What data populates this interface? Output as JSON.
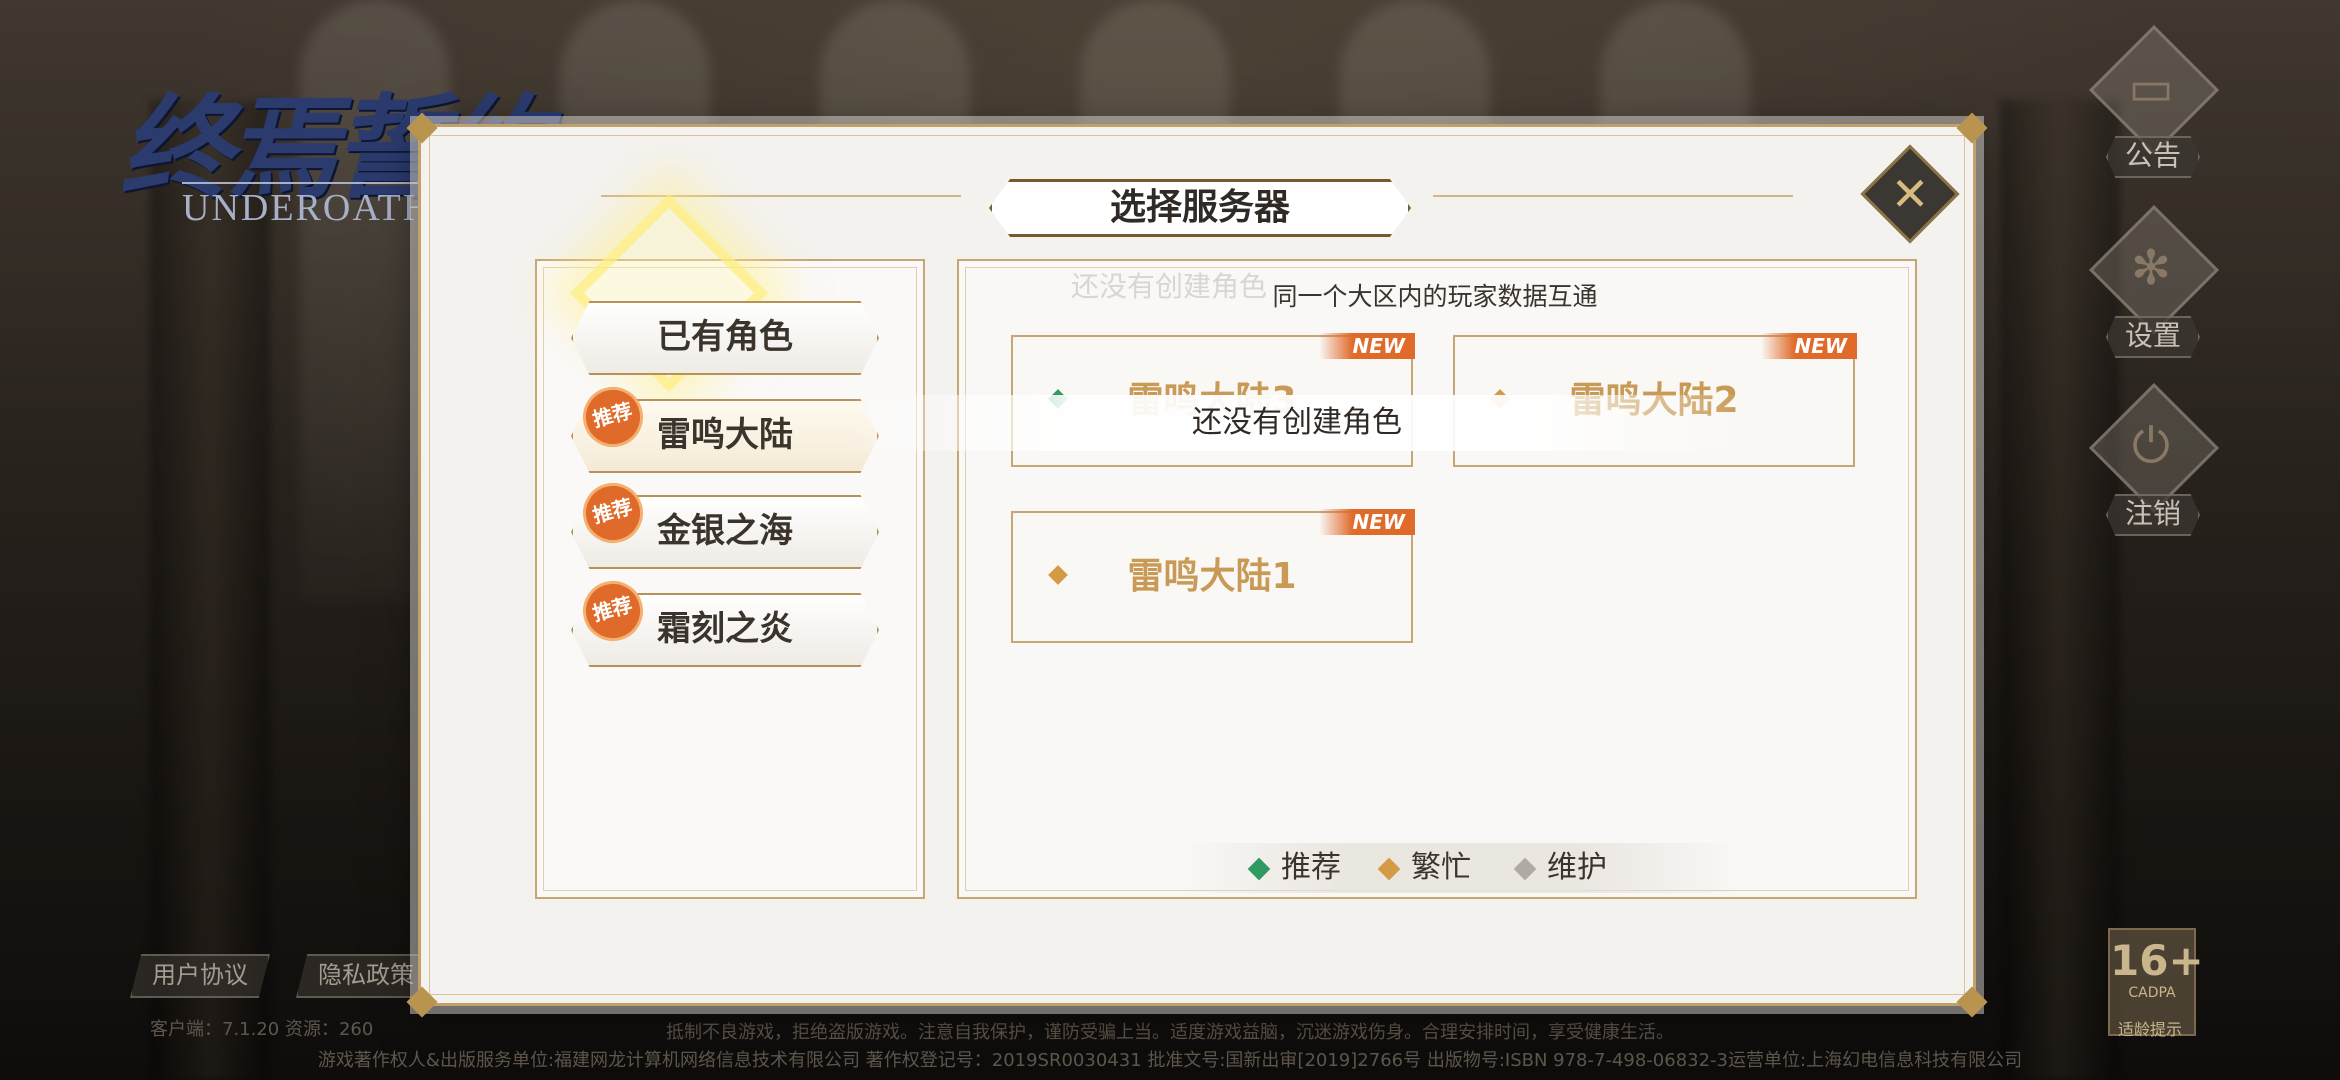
{
  "logo": {
    "title_cn": "终焉誓约",
    "title_en": "UNDEROATH"
  },
  "side_menu": [
    {
      "label": "公告",
      "icon": "notice-board-icon",
      "glyph": "▭"
    },
    {
      "label": "设置",
      "icon": "gear-icon",
      "glyph": "✻"
    },
    {
      "label": "注销",
      "icon": "power-icon",
      "glyph": "⏻"
    }
  ],
  "footer": {
    "user_agreement": "用户协议",
    "privacy_policy": "隐私政策",
    "version": "客户端：7.1.20  资源：260",
    "health_notice": "抵制不良游戏，拒绝盗版游戏。注意自我保护，谨防受骗上当。适度游戏益脑，沉迷游戏伤身。合理安排时间，享受健康生活。",
    "copyright": "游戏著作权人&出版服务单位:福建网龙计算机网络信息技术有限公司  著作权登记号：2019SR0030431  批准文号:国新出审[2019]2766号  出版物号:ISBN 978-7-498-06832-3运营单位:上海幻电信息科技有限公司",
    "age_rating": "16+",
    "age_org": "CADPA",
    "age_caption": "适龄提示"
  },
  "dialog": {
    "title": "选择服务器",
    "close_symbol": "✕",
    "hint": "同一个大区内的玩家数据互通",
    "empty_tooltip": "还没有创建角色",
    "region_tabs": [
      {
        "label": "已有角色",
        "recommended": false
      },
      {
        "label": "雷鸣大陆",
        "recommended": true
      },
      {
        "label": "金银之海",
        "recommended": true
      },
      {
        "label": "霜刻之炎",
        "recommended": true
      }
    ],
    "recommended_badge": "推荐",
    "servers": [
      {
        "name": "雷鸣大陆3",
        "tag": "NEW",
        "status": "recommended"
      },
      {
        "name": "雷鸣大陆2",
        "tag": "NEW",
        "status": "busy"
      },
      {
        "name": "雷鸣大陆1",
        "tag": "NEW",
        "status": "busy"
      }
    ],
    "legend": [
      {
        "label": "推荐",
        "color": "#2f9a62"
      },
      {
        "label": "繁忙",
        "color": "#d49a46"
      },
      {
        "label": "维护",
        "color": "#b0aaa2"
      }
    ]
  }
}
